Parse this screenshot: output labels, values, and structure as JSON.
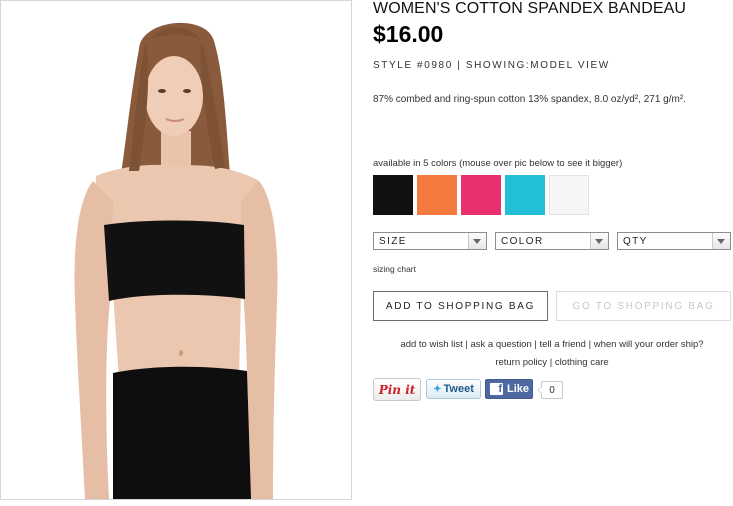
{
  "product": {
    "title": "WOMEN'S COTTON SPANDEX BANDEAU",
    "price": "$16.00",
    "meta": "STYLE #0980 | SHOWING:MODEL VIEW",
    "description": "87% combed and ring-spun cotton 13% spandex, 8.0 oz/yd², 271 g/m²."
  },
  "colors": {
    "available_text": "available in 5 colors (mouse over pic below to see it bigger)",
    "swatches": [
      {
        "name": "black",
        "hex": "#111111"
      },
      {
        "name": "orange",
        "hex": "#f47b3f"
      },
      {
        "name": "pink",
        "hex": "#e8306e"
      },
      {
        "name": "turquoise",
        "hex": "#22bfd6"
      },
      {
        "name": "white",
        "hex": "#f6f6f8"
      }
    ]
  },
  "selects": {
    "size": "SIZE",
    "color": "COLOR",
    "qty": "QTY"
  },
  "sizing_chart": "sizing chart",
  "buttons": {
    "add_to_bag": "ADD TO SHOPPING BAG",
    "go_to_bag": "GO TO SHOPPING BAG"
  },
  "links": {
    "wish_list": "add to wish list",
    "ask": "ask a question",
    "tell": "tell a friend",
    "ship": "when will your order ship?",
    "return_policy": "return policy",
    "care": "clothing care",
    "separator": " | "
  },
  "social": {
    "pin": "Pin it",
    "tweet": "Tweet",
    "like": "Like",
    "like_count": "0"
  }
}
